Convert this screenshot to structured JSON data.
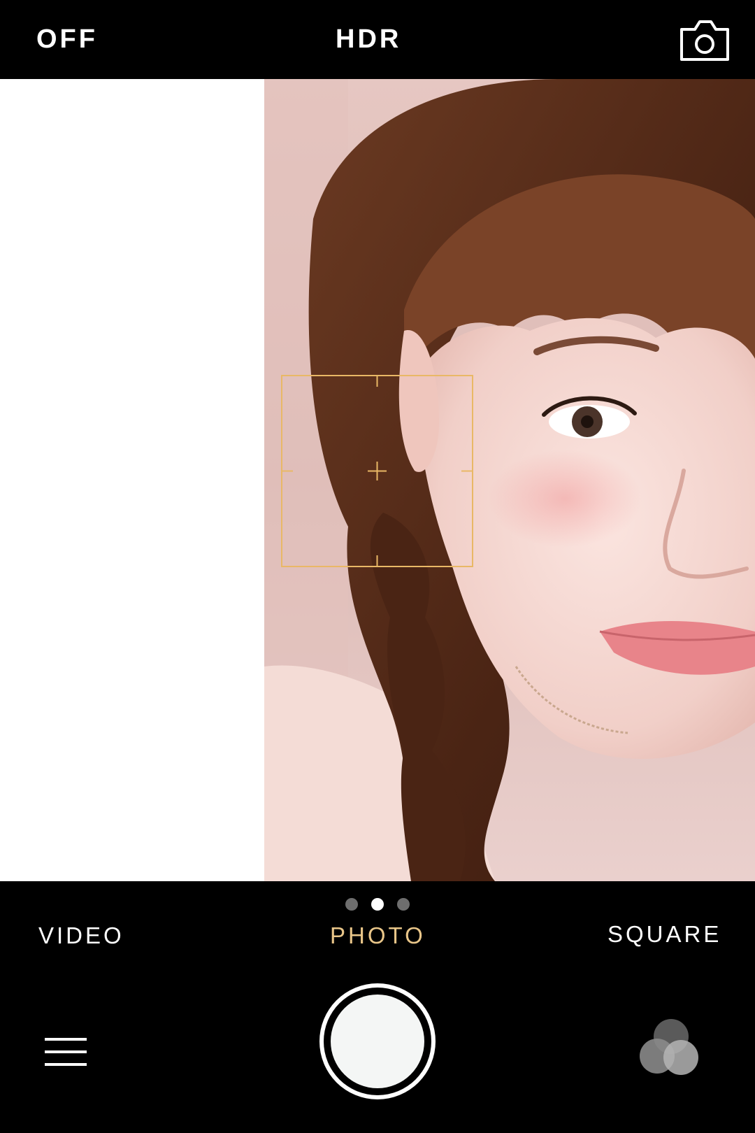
{
  "top_bar": {
    "flash_label": "OFF",
    "hdr_label": "HDR",
    "switch_camera_icon": "camera-switch-icon"
  },
  "viewfinder": {
    "focus_icon": "focus-crosshair-icon",
    "accent_color": "#e9b866"
  },
  "bottom_bar": {
    "page_indicator": {
      "total": 3,
      "active_index": 1
    },
    "modes": [
      "VIDEO",
      "PHOTO",
      "SQUARE"
    ],
    "active_mode": "PHOTO",
    "active_color": "#e9c689",
    "shutter_icon": "shutter-button",
    "menu_icon": "hamburger-menu-icon",
    "filters_icon": "filters-circles-icon"
  }
}
